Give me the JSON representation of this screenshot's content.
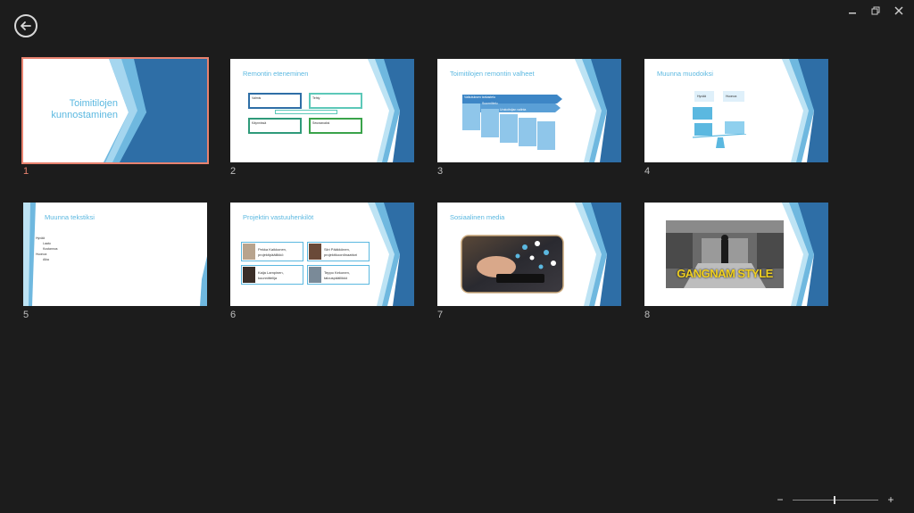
{
  "window": {
    "minimize": "–",
    "restore": "❐",
    "close": "✕"
  },
  "slides": [
    {
      "number": "1",
      "title_line1": "Toimitilojen",
      "title_line2": "kunnostaminen"
    },
    {
      "number": "2",
      "title": "Remontin eteneminen",
      "boxes": [
        "Valmis",
        "Tehty",
        "Käynnissä",
        "Seuraavaksi"
      ]
    },
    {
      "number": "3",
      "title": "Toimitilojen remontin valheet",
      "steps": [
        "Vaikutuksen tarkastelu",
        "Suunnittelu",
        "Urakoitsijan valinta",
        "Rakentaminen",
        "Arviointi"
      ]
    },
    {
      "number": "4",
      "title": "Muunna muodoiksi",
      "labels": [
        "Hyvää",
        "Huonoa"
      ]
    },
    {
      "number": "5",
      "title": "Muunna tekstiksi",
      "bullets": [
        "Hyvää",
        "Laatu",
        "Kustannus",
        "Huonoa",
        "Aika"
      ]
    },
    {
      "number": "6",
      "title": "Projektin vastuuhenkilöt",
      "people": [
        {
          "name": "Pekka Kaikkonen,",
          "role": "projektipäällikkö"
        },
        {
          "name": "Siiri Pääkkönen,",
          "role": "projektikoordinaattori"
        },
        {
          "name": "Kaija Lampinen,",
          "role": "kuunnittelija"
        },
        {
          "name": "Teppo Kekonen,",
          "role": "talouspäällikkö"
        }
      ]
    },
    {
      "number": "7",
      "title": "Sosiaalinen media"
    },
    {
      "number": "8",
      "title": "",
      "image_text": "GANGNAM STYLE"
    }
  ],
  "zoom": {
    "minus": "−",
    "plus": "+",
    "level": 0.5
  },
  "colors": {
    "accent": "#e8826f",
    "slide_blue": "#2e6ea6",
    "light_blue": "#5bb8e0"
  }
}
